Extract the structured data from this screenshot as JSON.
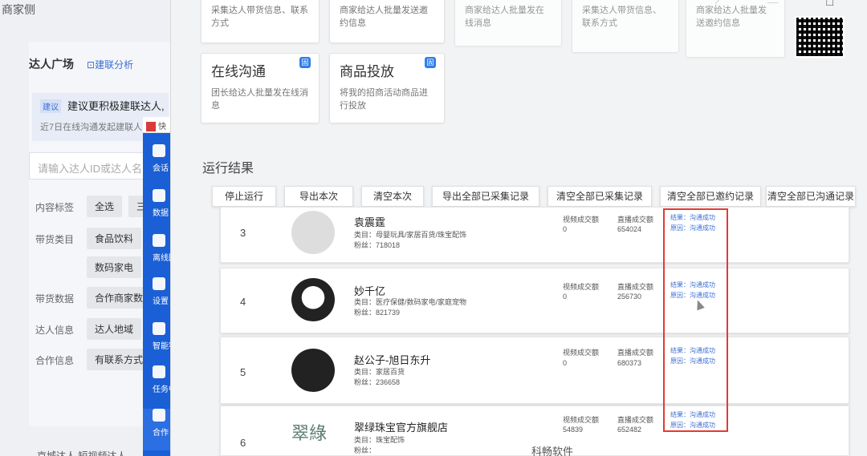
{
  "background_page": {
    "header": "商家侧",
    "title": "达人广场",
    "link": "建联分析",
    "tip_tag": "建议",
    "tip_text": "建议更积极建联达人,",
    "tip_sub": "近7日在线沟通发起建联人",
    "search_placeholder": "请输入达人ID或达人名",
    "rows": [
      {
        "label": "内容标签",
        "chips": [
          "全选",
          "三"
        ]
      },
      {
        "label": "带货类目",
        "chips": [
          "食品饮料",
          "数码家电"
        ]
      },
      {
        "label": "带货数据",
        "chips": [
          "合作商家数"
        ]
      },
      {
        "label": "达人信息",
        "chips": [
          "达人地域"
        ]
      },
      {
        "label": "合作信息",
        "chips": [
          "有联系方式"
        ]
      }
    ],
    "bottom": "京城达人    短视频达人"
  },
  "mini_app": {
    "title": "快",
    "sidebar": [
      {
        "label": "会话",
        "icon": "chat-icon"
      },
      {
        "label": "数据",
        "icon": "chart-icon"
      },
      {
        "label": "离线回复",
        "icon": "message-icon"
      },
      {
        "label": "设置",
        "icon": "settings-icon"
      },
      {
        "label": "智能客服",
        "icon": "robot-icon"
      },
      {
        "label": "任务中心",
        "icon": "task-icon"
      },
      {
        "label": "合作",
        "icon": "people-icon"
      }
    ]
  },
  "tool": {
    "top_cards": [
      {
        "desc": "采集达人带货信息、联系方式"
      },
      {
        "desc": "商家给达人批量发送邀约信息"
      },
      {
        "desc": "商家给达人批量发在线消息"
      },
      {
        "desc": "采集达人带货信息、联系方式"
      },
      {
        "desc": "商家给达人批量发送邀约信息"
      }
    ],
    "feature_cards": [
      {
        "title": "在线沟通",
        "desc": "团长给达人批量发在线消息",
        "badge": "固"
      },
      {
        "title": "商品投放",
        "desc": "将我的招商活动商品进行投放",
        "badge": "固"
      }
    ],
    "section_title": "运行结果",
    "toolbar": [
      "停止运行",
      "导出本次",
      "清空本次",
      "导出全部已采集记录",
      "清空全部已采集记录",
      "清空全部已邀约记录",
      "清空全部已沟通记录"
    ],
    "results": [
      {
        "index": "3",
        "name": "袁震霆",
        "category": "类目：母婴玩具/家居百货/珠宝配饰",
        "fans": "粉丝：718018",
        "video_label": "视频成交额",
        "video_value": "0",
        "live_label": "直播成交额",
        "live_value": "654024",
        "result": "结果：沟通成功",
        "reason": "原因：沟通成功"
      },
      {
        "index": "4",
        "name": "妙千亿",
        "category": "类目：医疗保健/数码家电/家庭宠物",
        "fans": "粉丝：821739",
        "video_label": "视频成交额",
        "video_value": "0",
        "live_label": "直播成交额",
        "live_value": "256730",
        "result": "结果：沟通成功",
        "reason": "原因：沟通成功"
      },
      {
        "index": "5",
        "name": "赵公子-旭日东升",
        "category": "类目：家居百货",
        "fans": "粉丝：236658",
        "video_label": "视频成交额",
        "video_value": "0",
        "live_label": "直播成交额",
        "live_value": "680373",
        "result": "结果：沟通成功",
        "reason": "原因：沟通成功"
      },
      {
        "index": "6",
        "name": "翠绿珠宝官方旗舰店",
        "category": "类目：珠宝配饰",
        "fans": "粉丝：",
        "video_label": "视频成交额",
        "video_value": "54839",
        "live_label": "直播成交额",
        "live_value": "652482",
        "result": "结果：沟通成功",
        "reason": "原因：沟通成功",
        "avatar_text": "翠綠"
      }
    ],
    "footer": "科畅软件",
    "window_controls": "? — □"
  }
}
